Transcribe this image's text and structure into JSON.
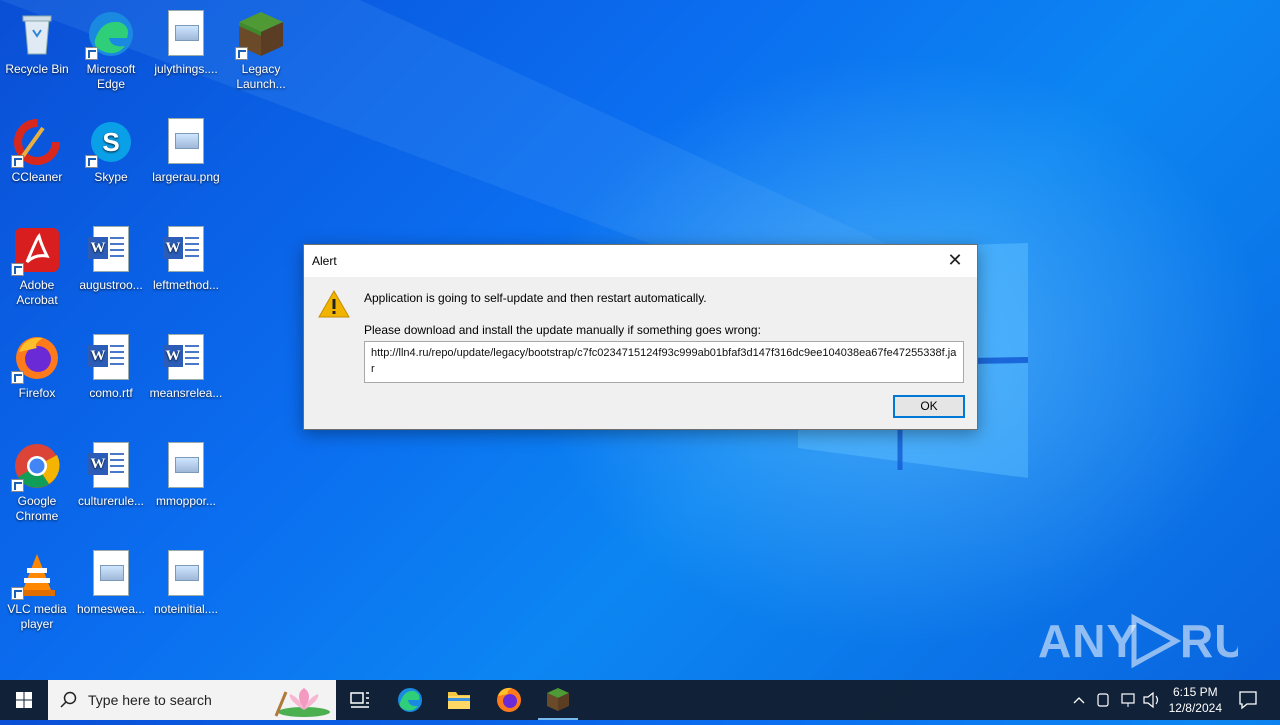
{
  "desktop": {
    "icons": [
      {
        "label": "Recycle Bin"
      },
      {
        "label": "Microsoft Edge"
      },
      {
        "label": "julythings...."
      },
      {
        "label": "Legacy Launch..."
      },
      {
        "label": "CCleaner"
      },
      {
        "label": "Skype"
      },
      {
        "label": "largerau.png"
      },
      {
        "label": "Adobe Acrobat"
      },
      {
        "label": "augustroo..."
      },
      {
        "label": "leftmethod..."
      },
      {
        "label": "Firefox"
      },
      {
        "label": "como.rtf"
      },
      {
        "label": "meansrelea..."
      },
      {
        "label": "Google Chrome"
      },
      {
        "label": "culturerule..."
      },
      {
        "label": "mmoppor..."
      },
      {
        "label": "VLC media player"
      },
      {
        "label": "homeswea..."
      },
      {
        "label": "noteinitial...."
      }
    ]
  },
  "dialog": {
    "title": "Alert",
    "message1": "Application is going to self-update and then restart automatically.",
    "message2": "Please download and install the update manually if something goes wrong:",
    "url": "http://lln4.ru/repo/update/legacy/bootstrap/c7fc0234715124f93c999ab01bfaf3d147f316dc9ee104038ea67fe47255338f.jar",
    "ok_label": "OK",
    "icon": "warning-icon"
  },
  "taskbar": {
    "search_placeholder": "Type here to search",
    "time": "6:15 PM",
    "date": "12/8/2024"
  },
  "watermark": "ANY RUN",
  "colors": {
    "accent": "#0078d7",
    "taskbar": "#121e30"
  }
}
